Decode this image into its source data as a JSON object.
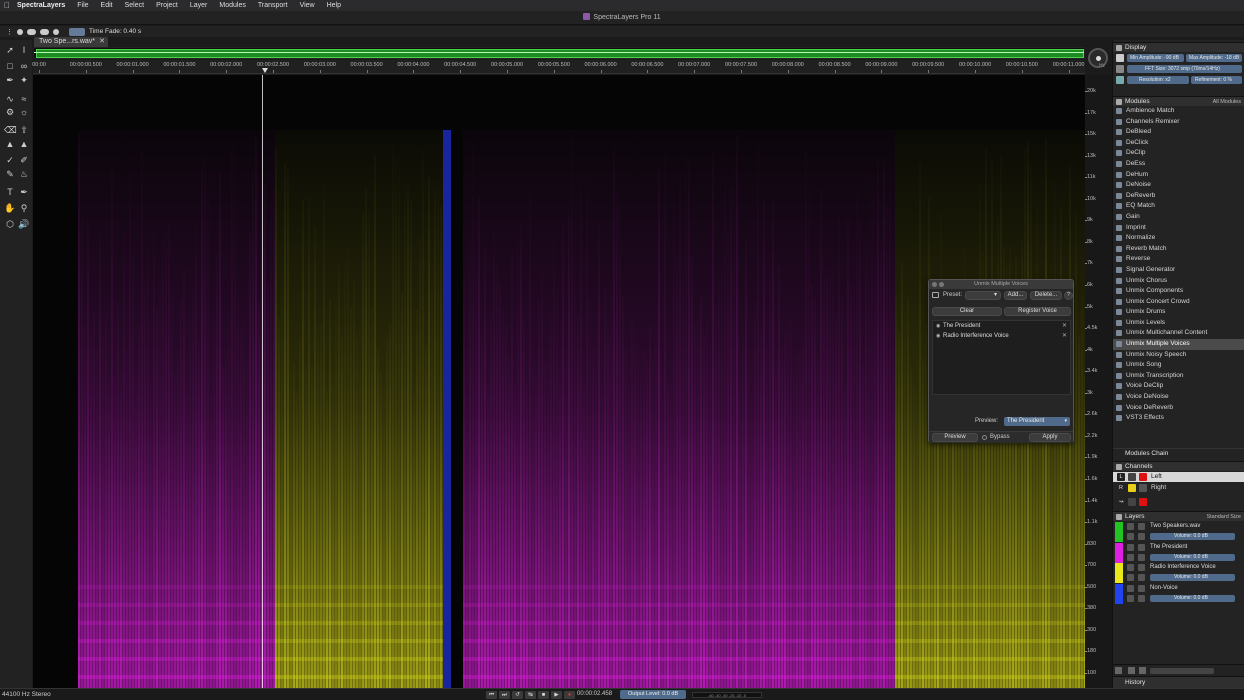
{
  "menubar": {
    "app_name": "SpectraLayers",
    "items": [
      "File",
      "Edit",
      "Select",
      "Project",
      "Layer",
      "Modules",
      "Transport",
      "View",
      "Help"
    ]
  },
  "window": {
    "title": "SpectraLayers Pro 11"
  },
  "tool_options": {
    "time_fade_label": "Time Fade: 0.40 s"
  },
  "document": {
    "tab_name": "Two Spe...rs.wav*"
  },
  "timeline": {
    "ticks": [
      "00:00",
      "00:00:00.500",
      "00:00:01.000",
      "00:00:01.500",
      "00:00:02.000",
      "00:00:02.500",
      "00:00:03.000",
      "00:00:03.500",
      "00:00:04.000",
      "00:00:04.500",
      "00:00:05.000",
      "00:00:05.500",
      "00:00:06.000",
      "00:00:06.500",
      "00:00:07.000",
      "00:00:07.500",
      "00:00:08.000",
      "00:00:08.500",
      "00:00:09.000",
      "00:00:09.500",
      "00:00:10.000",
      "00:00:10.500",
      "00:00:11.000"
    ]
  },
  "freq_scale": {
    "unit": "Hz",
    "labels": [
      "20k",
      "17k",
      "15k",
      "13k",
      "11k",
      "10k",
      "9k",
      "8k",
      "7k",
      "6k",
      "5k",
      "4.5k",
      "4k",
      "3.4k",
      "3k",
      "2.6k",
      "2.2k",
      "1.9k",
      "1.6k",
      "1.4k",
      "1.1k",
      "830",
      "700",
      "500",
      "380",
      "300",
      "180",
      "100"
    ]
  },
  "display": {
    "title": "Display",
    "min_amplitude": "Min Amplitude: -90 dB",
    "max_amplitude": "Max Amplitude: -18 dB",
    "fft_size": "FFT Size: 3072 smp (70ms/14Hz)",
    "resolution": "Resolution: x2",
    "refinement": "Refinement: 0 %"
  },
  "modules": {
    "title": "Modules",
    "filter": "All Modules",
    "items": [
      "Ambience Match",
      "Channels Remixer",
      "DeBleed",
      "DeClick",
      "DeClip",
      "DeEss",
      "DeHum",
      "DeNoise",
      "DeReverb",
      "EQ Match",
      "Gain",
      "Imprint",
      "Normalize",
      "Reverb Match",
      "Reverse",
      "Signal Generator",
      "Unmix Chorus",
      "Unmix Components",
      "Unmix Concert Crowd",
      "Unmix Drums",
      "Unmix Levels",
      "Unmix Multichannel Content",
      "Unmix Multiple Voices",
      "Unmix Noisy Speech",
      "Unmix Song",
      "Unmix Transcription",
      "Voice DeClip",
      "Voice DeNoise",
      "Voice DeReverb",
      "VST3 Effects"
    ],
    "active_index": 22
  },
  "modules_chain": {
    "label": "Modules Chain"
  },
  "channels": {
    "title": "Channels",
    "items": [
      {
        "letter": "L",
        "name": "Left"
      },
      {
        "letter": "R",
        "name": "Right"
      }
    ]
  },
  "layers": {
    "title": "Layers",
    "size_label": "Standard Size",
    "items": [
      {
        "name": "Two Speakers.wav",
        "volume": "Volume: 0.0 dB",
        "color": "#22c422"
      },
      {
        "name": "The President",
        "volume": "Volume: 0.0 dB",
        "color": "#e020e0"
      },
      {
        "name": "Radio Interference Voice",
        "volume": "Volume: 0.0 dB",
        "color": "#e8e81a"
      },
      {
        "name": "Non-Voice",
        "volume": "Volume: 0.0 dB",
        "color": "#2244ee"
      }
    ]
  },
  "history": {
    "title": "History"
  },
  "dialog": {
    "title": "Unmix Multiple Voices",
    "preset_label": "Preset:",
    "add_button": "Add...",
    "delete_button": "Delete...",
    "help_glyph": "?",
    "clear_button": "Clear",
    "register_button": "Register Voice",
    "voices": [
      "The President",
      "Radio Interference Voice"
    ],
    "preview_label": "Preview:",
    "preview_selected": "The President",
    "preview_button": "Preview",
    "bypass_label": "Bypass",
    "apply_button": "Apply"
  },
  "status": {
    "format": "44100 Hz Stereo",
    "timecode": "00:00:02.458",
    "output_level": "Output Level: 0.0 dB",
    "meter_scale": "-60 -40 -30 -25 -15 -5"
  },
  "colors": {
    "voice1": "#e020e0",
    "voice2": "#d8d81a",
    "nonvoice": "#2233dd",
    "accent": "#4f6a8a"
  }
}
